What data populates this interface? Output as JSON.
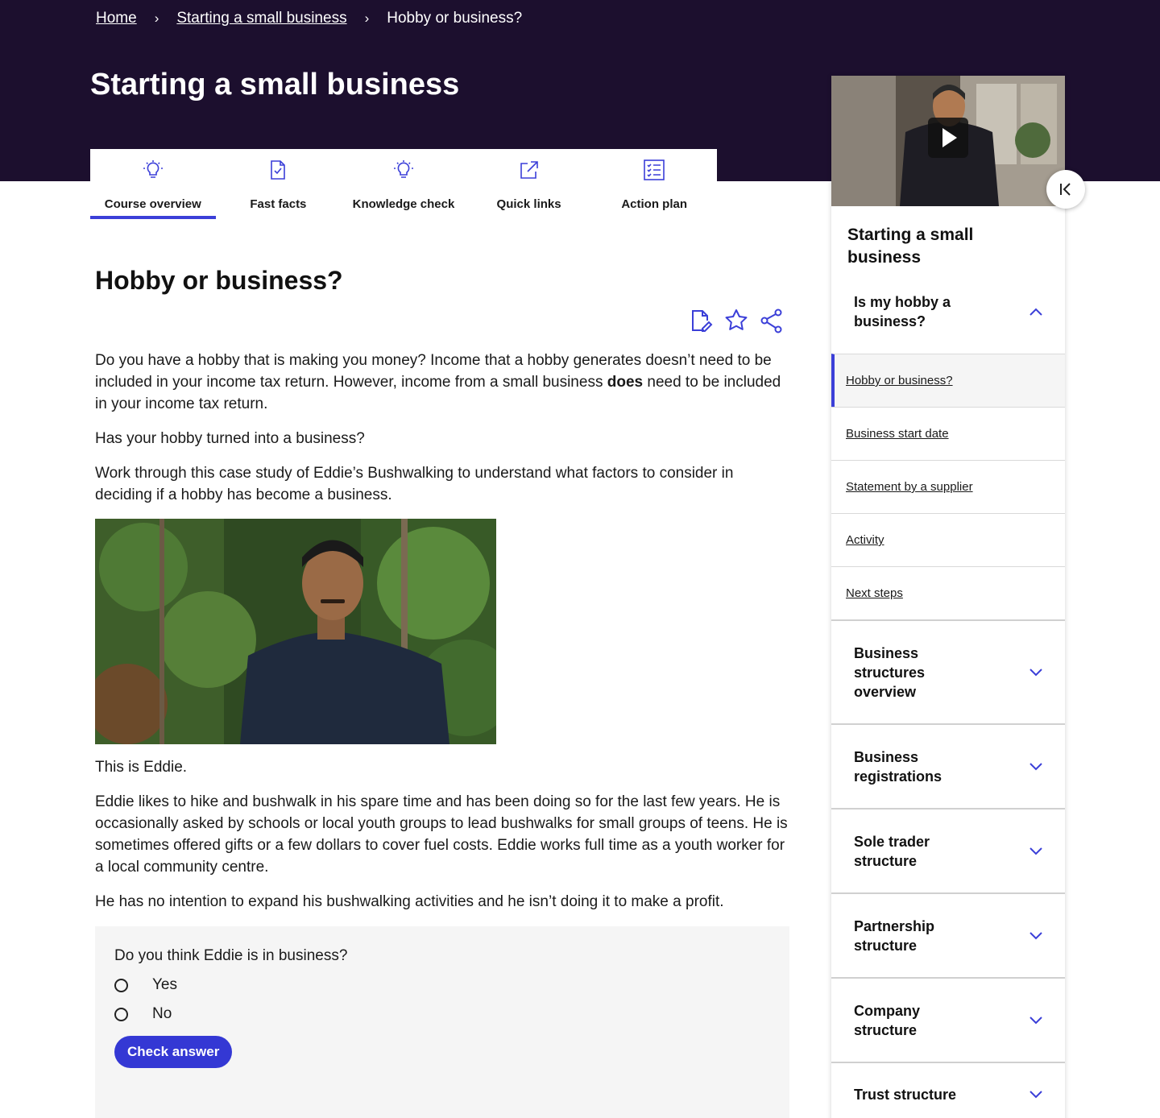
{
  "breadcrumb": {
    "home": "Home",
    "parent": "Starting a small business",
    "current": "Hobby or business?",
    "separator": "›"
  },
  "page_title": "Starting a small business",
  "tabs": [
    {
      "label": "Course overview",
      "icon": "lightbulb-icon",
      "active": true
    },
    {
      "label": "Fast facts",
      "icon": "document-check-icon",
      "active": false
    },
    {
      "label": "Knowledge check",
      "icon": "lightbulb-icon",
      "active": false
    },
    {
      "label": "Quick links",
      "icon": "external-link-icon",
      "active": false
    },
    {
      "label": "Action plan",
      "icon": "checklist-icon",
      "active": false
    }
  ],
  "article": {
    "heading": "Hobby or business?",
    "actions": [
      "edit-note-icon",
      "star-icon",
      "share-icon"
    ],
    "p1_before": "Do you have a hobby that is making you money? Income that a hobby generates doesn’t need to be included in your income tax return. However, income from a small business ",
    "p1_bold": "does",
    "p1_after": " need to be included in your income tax return.",
    "p2": "Has your hobby turned into a business?",
    "p3": "Work through this case study of Eddie’s Bushwalking to understand what factors to consider in deciding if a hobby has become a business.",
    "caption": "This is Eddie.",
    "p4": "Eddie likes to hike and bushwalk in his spare time and has been doing so for the last few years. He is occasionally asked by schools or local youth groups to lead bushwalks for small groups of teens. He is sometimes offered gifts or a few dollars to cover fuel costs. Eddie works full time as a youth worker for a local community centre.",
    "p5": "He has no intention to expand his bushwalking activities and he isn’t doing it to make a profit."
  },
  "quiz": {
    "question": "Do you think Eddie is in business?",
    "options": [
      "Yes",
      "No"
    ],
    "button": "Check answer"
  },
  "sidebar": {
    "title": "Starting a small business",
    "open_section": {
      "label": "Is my hobby a business?",
      "items": [
        "Hobby or business?",
        "Business start date",
        "Statement by a supplier",
        "Activity",
        "Next steps"
      ],
      "current_index": 0
    },
    "sections": [
      "Business structures overview",
      "Business registrations",
      "Sole trader structure",
      "Partnership structure",
      "Company structure",
      "Trust structure"
    ]
  },
  "colors": {
    "hero": "#1c0f2e",
    "accent": "#3b3fd8",
    "button": "#3438d4"
  }
}
